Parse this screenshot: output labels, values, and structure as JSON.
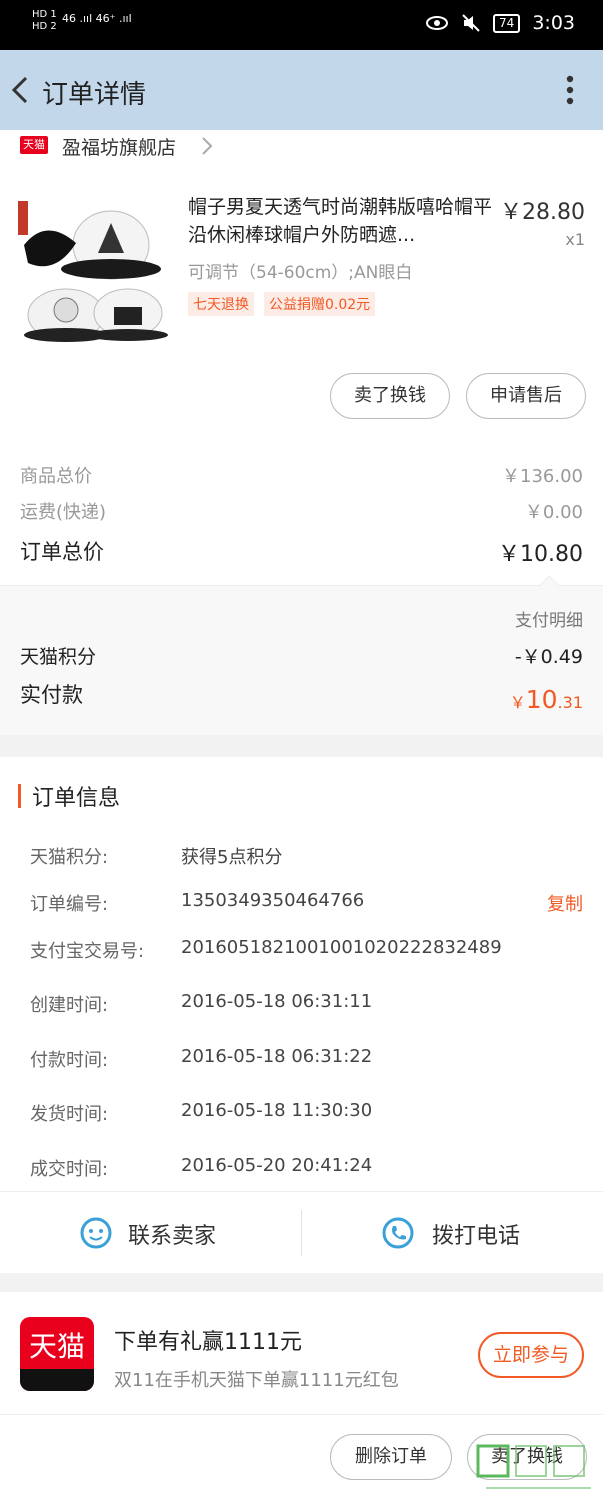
{
  "status_bar": {
    "left_top": "HD 1",
    "left_bottom": "HD 2",
    "signal": "46 .ııl  46⁺ .ııl",
    "battery": "74",
    "time": "3:03"
  },
  "nav": {
    "title": "订单详情"
  },
  "store": {
    "badge": "天猫",
    "name": "盈福坊旗舰店"
  },
  "product": {
    "title": "帽子男夏天透气时尚潮韩版嘻哈帽平沿休闲棒球帽户外防晒遮...",
    "price": "￥28.80",
    "qty": "x1",
    "spec": "可调节（54-60cm）;AN眼白",
    "tags": [
      "七天退换",
      "公益捐赠0.02元"
    ]
  },
  "item_actions": {
    "sell": "卖了换钱",
    "after_sales": "申请售后"
  },
  "price_summary": {
    "goods_total_label": "商品总价",
    "goods_total": "￥136.00",
    "shipping_label": "运费(快递)",
    "shipping": "￥0.00",
    "order_total_label": "订单总价",
    "order_total": "￥10.80",
    "pay_detail": "支付明细",
    "points_label": "天猫积分",
    "points": "-￥0.49",
    "paid_label": "实付款",
    "paid_currency": "￥",
    "paid_int": "10",
    "paid_dec": ".31"
  },
  "order_info": {
    "title": "订单信息",
    "rows": [
      {
        "k": "天猫积分:",
        "v": "获得5点积分"
      },
      {
        "k": "订单编号:",
        "v": "1350349350464766",
        "action": "复制"
      },
      {
        "k": "支付宝交易号:",
        "v": "2016051821001001020222832489"
      },
      {
        "k": "创建时间:",
        "v": "2016-05-18 06:31:11"
      },
      {
        "k": "付款时间:",
        "v": "2016-05-18 06:31:22"
      },
      {
        "k": "发货时间:",
        "v": "2016-05-18 11:30:30"
      },
      {
        "k": "成交时间:",
        "v": "2016-05-20 20:41:24"
      }
    ],
    "contact_seller": "联系卖家",
    "call_phone": "拨打电话"
  },
  "promo": {
    "logo_text": "天猫",
    "title": "下单有礼赢1111元",
    "subtitle": "双11在手机天猫下单赢1111元红包",
    "join": "立即参与"
  },
  "bottom_actions": {
    "delete": "删除订单",
    "sell": "卖了换钱"
  },
  "colors": {
    "accent": "#f15a24",
    "tmall_red": "#e8001c",
    "nav_bg": "#c3d7ea",
    "icon_blue": "#3aa0d8"
  }
}
